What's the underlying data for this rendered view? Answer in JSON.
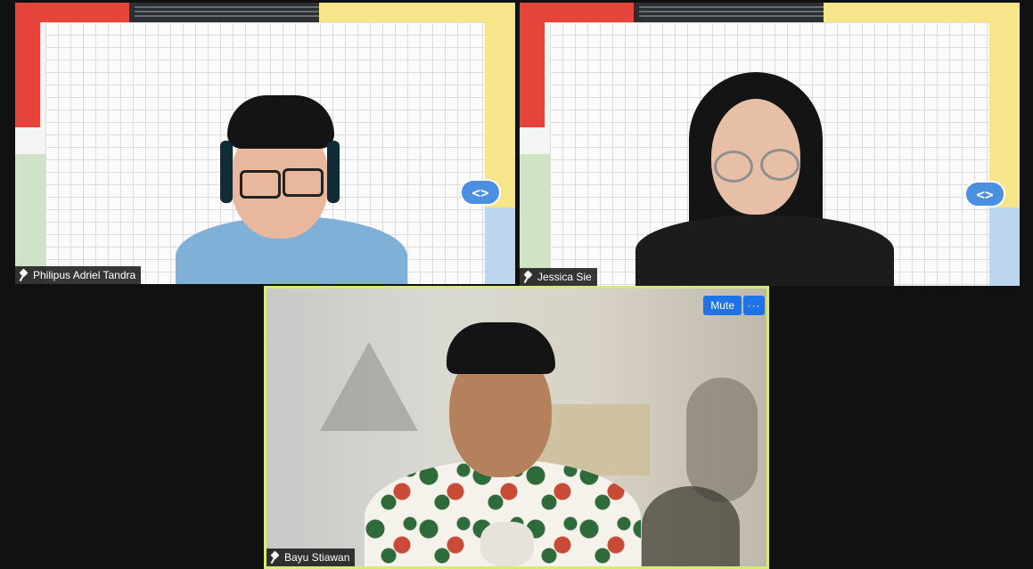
{
  "participants": [
    {
      "name": "Philipus Adriel Tandra",
      "pinned_icon": "pin-icon",
      "background_badge": "<>"
    },
    {
      "name": "Jessica Sie",
      "pinned_icon": "pin-icon",
      "background_badge": "<>"
    },
    {
      "name": "Bayu Stiawan",
      "pinned_icon": "pin-icon",
      "active_speaker": true
    }
  ],
  "controls": {
    "mute_label": "Mute",
    "more_label": "···"
  },
  "colors": {
    "active_speaker_border": "#d7ea76",
    "button_blue": "#1e73e8",
    "badge_blue": "#4a8fe0"
  }
}
